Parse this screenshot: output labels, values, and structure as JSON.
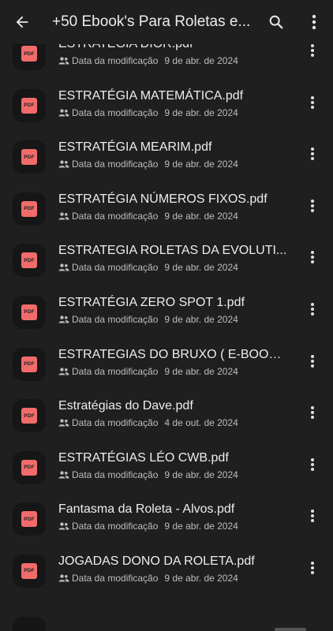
{
  "header": {
    "title": "+50 Ebook's Para Roletas e...",
    "icons": {
      "back": "arrow-back-icon",
      "search": "search-icon",
      "more": "more-vert-icon"
    }
  },
  "files": [
    {
      "name": "ESTRATÉGIA DIOR.pdf",
      "meta_label": "Data da modificação",
      "date": "9 de abr. de 2024",
      "type": "PDF"
    },
    {
      "name": "ESTRATÉGIA MATEMÁTICA.pdf",
      "meta_label": "Data da modificação",
      "date": "9 de abr. de 2024",
      "type": "PDF"
    },
    {
      "name": "ESTRATÉGIA MEARIM.pdf",
      "meta_label": "Data da modificação",
      "date": "9 de abr. de 2024",
      "type": "PDF"
    },
    {
      "name": "ESTRATÉGIA NÚMEROS FIXOS.pdf",
      "meta_label": "Data da modificação",
      "date": "9 de abr. de 2024",
      "type": "PDF"
    },
    {
      "name": "ESTRATEGIA ROLETAS DA EVOLUTI...",
      "meta_label": "Data da modificação",
      "date": "9 de abr. de 2024",
      "type": "PDF"
    },
    {
      "name": "ESTRATÉGIA ZERO SPOT 1.pdf",
      "meta_label": "Data da modificação",
      "date": "9 de abr. de 2024",
      "type": "PDF"
    },
    {
      "name": "ESTRATEGIAS DO BRUXO ( E-BOOK ...",
      "meta_label": "Data da modificação",
      "date": "9 de abr. de 2024",
      "type": "PDF"
    },
    {
      "name": "Estratégias do Dave.pdf",
      "meta_label": "Data da modificação",
      "date": "4 de out. de 2024",
      "type": "PDF"
    },
    {
      "name": "ESTRATÉGIAS LÉO CWB.pdf",
      "meta_label": "Data da modificação",
      "date": "9 de abr. de 2024",
      "type": "PDF"
    },
    {
      "name": "Fantasma da Roleta - Alvos.pdf",
      "meta_label": "Data da modificação",
      "date": "9 de abr. de 2024",
      "type": "PDF"
    },
    {
      "name": "JOGADAS DONO DA ROLETA.pdf",
      "meta_label": "Data da modificação",
      "date": "9 de abr. de 2024",
      "type": "PDF"
    }
  ],
  "colors": {
    "background": "#1f1f1f",
    "pdf_badge": "#f26b6b",
    "text": "#ededed",
    "meta_text": "#bdbdbd"
  }
}
